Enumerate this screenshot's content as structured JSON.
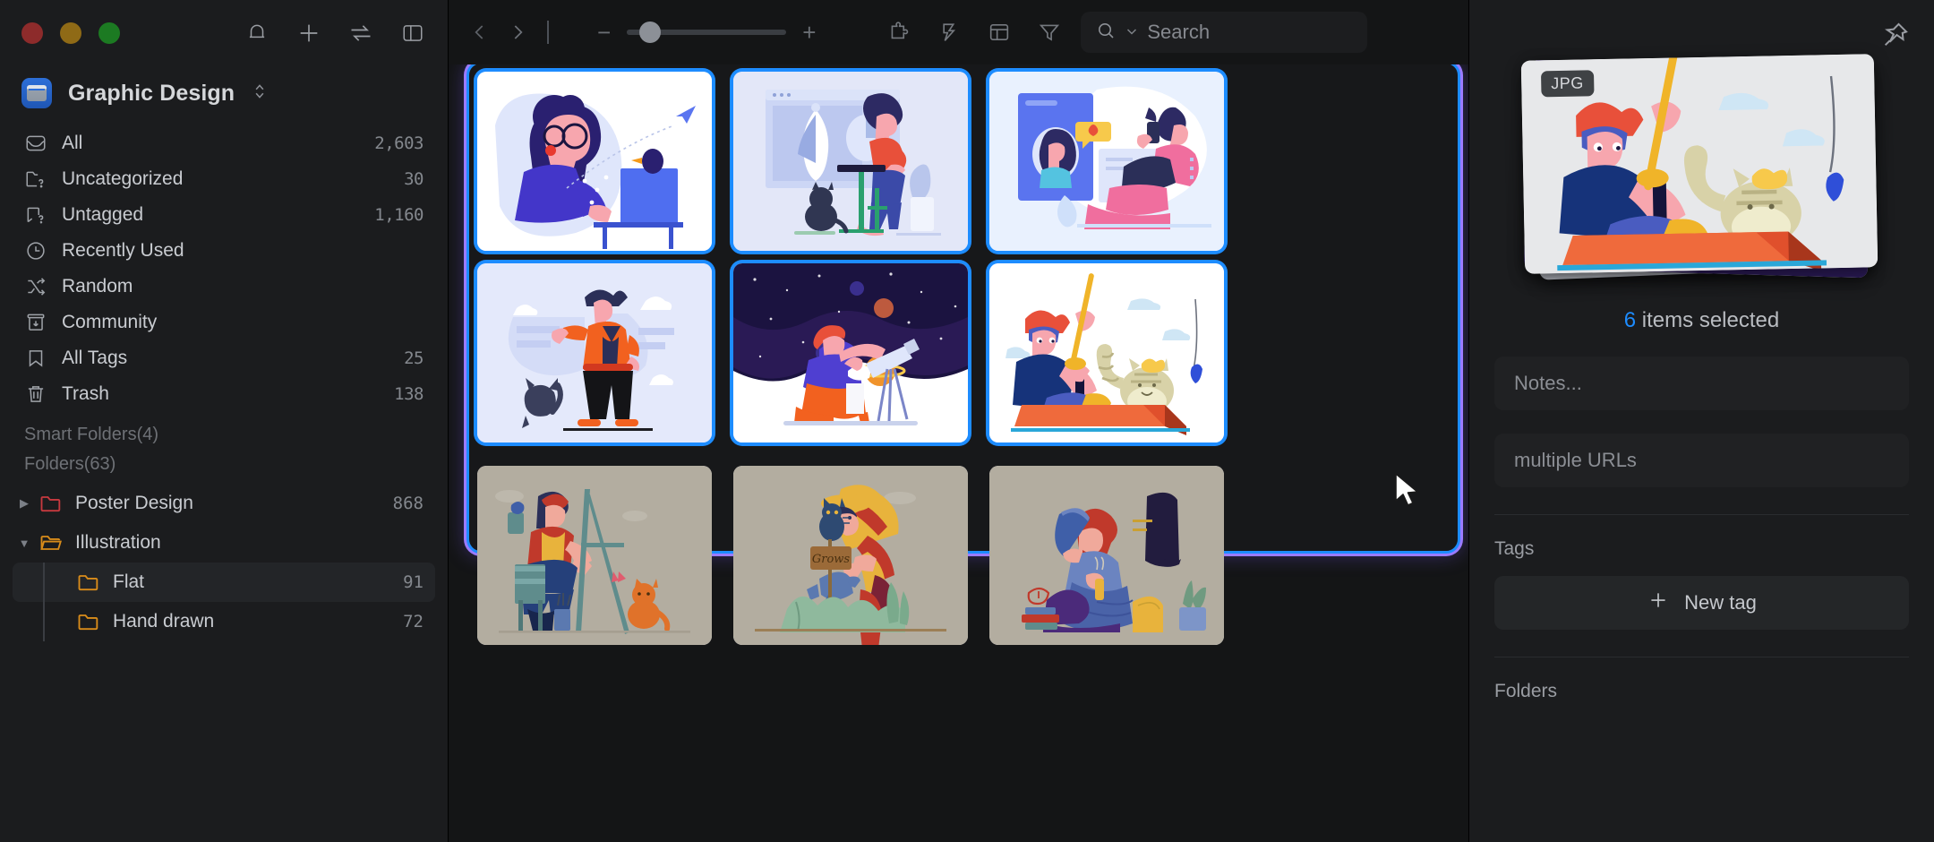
{
  "window": {
    "traffic_lights": [
      "close",
      "minimize",
      "zoom"
    ],
    "header_icons": [
      "bell-icon",
      "plus-icon",
      "transfer-icon",
      "toggle-sidebar-icon"
    ]
  },
  "sidebar": {
    "library": {
      "name": "Graphic Design",
      "icon": "library-icon",
      "chevron": "⌃⌄"
    },
    "nav": [
      {
        "label": "All",
        "count": "2,603",
        "icon": "inbox-icon"
      },
      {
        "label": "Uncategorized",
        "count": "30",
        "icon": "folder-question-icon"
      },
      {
        "label": "Untagged",
        "count": "1,160",
        "icon": "tag-question-icon"
      },
      {
        "label": "Recently Used",
        "count": "",
        "icon": "clock-icon"
      },
      {
        "label": "Random",
        "count": "",
        "icon": "shuffle-icon"
      },
      {
        "label": "Community",
        "count": "",
        "icon": "community-icon"
      },
      {
        "label": "All Tags",
        "count": "25",
        "icon": "bookmark-icon"
      },
      {
        "label": "Trash",
        "count": "138",
        "icon": "trash-icon"
      }
    ],
    "smart_folders_label": "Smart Folders(4)",
    "folders_label": "Folders(63)",
    "folders": [
      {
        "label": "Poster Design",
        "count": "868",
        "color": "#c7393f",
        "expanded": false,
        "depth": 0,
        "selected": false
      },
      {
        "label": "Illustration",
        "count": "",
        "color": "#d98c1a",
        "expanded": true,
        "depth": 0,
        "selected": false
      },
      {
        "label": "Flat",
        "count": "91",
        "color": "#d98c1a",
        "expanded": null,
        "depth": 1,
        "selected": true
      },
      {
        "label": "Hand drawn",
        "count": "72",
        "color": "#d98c1a",
        "expanded": null,
        "depth": 1,
        "selected": false
      }
    ]
  },
  "toolbar": {
    "back_icon": "chevron-left-icon",
    "forward_icon": "chevron-right-icon",
    "zoom_out": "−",
    "zoom_in": "+",
    "zoom_value": 12,
    "right_icons": [
      "extension-icon",
      "lightning-icon",
      "layout-icon",
      "filter-icon"
    ],
    "search": {
      "placeholder": "Search",
      "value": "",
      "icon": "search-icon",
      "caret": "chevron-down-icon"
    }
  },
  "grid": {
    "selection_active": true,
    "items": [
      {
        "name": "woman-at-laptop-with-bird",
        "selected": true,
        "bg": "#ffffff"
      },
      {
        "name": "man-designing-on-laptop",
        "selected": true,
        "bg": "#e3e7f8"
      },
      {
        "name": "video-call-couple",
        "selected": true,
        "bg": "#e9f1fe"
      },
      {
        "name": "man-standing-with-cat",
        "selected": true,
        "bg": "#e4e9fb"
      },
      {
        "name": "father-child-telescope",
        "selected": true,
        "bg": "#ffffff"
      },
      {
        "name": "man-fishing-with-cat",
        "selected": true,
        "bg": "#ffffff"
      },
      {
        "name": "artist-at-easel-with-cat",
        "selected": false,
        "bg": "#b3ada0"
      },
      {
        "name": "gardener-watering-plants",
        "selected": false,
        "bg": "#b3ada0"
      },
      {
        "name": "man-reading-book",
        "selected": false,
        "bg": "#b3ada0"
      }
    ]
  },
  "inspector": {
    "pin_icon": "pin-icon",
    "file_badge": "JPG",
    "selection_text_count": "6",
    "selection_text_rest": " items selected",
    "notes_placeholder": "Notes...",
    "url_placeholder": "multiple URLs",
    "tags_label": "Tags",
    "new_tag_label": "New tag",
    "folders_label": "Folders"
  },
  "colors": {
    "accent": "#1d8cff",
    "selection_glow": "#9b7bff",
    "sidebar_bg": "#1b1c1e",
    "canvas_bg": "#141516"
  }
}
